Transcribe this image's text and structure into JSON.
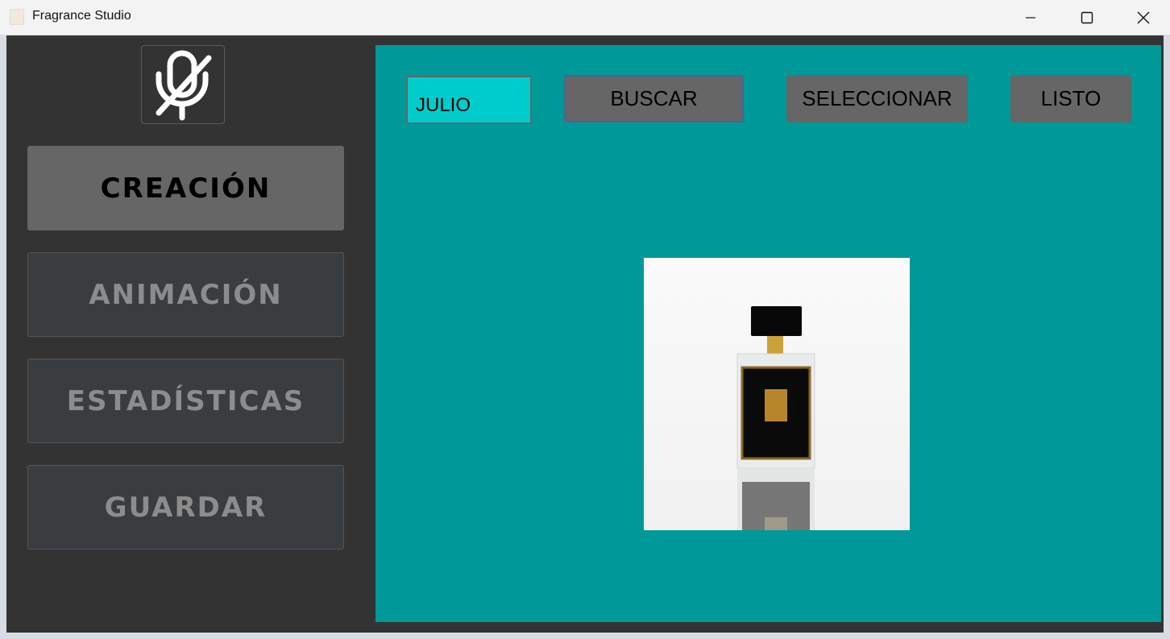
{
  "window": {
    "title": "Fragrance Studio"
  },
  "sidebar": {
    "items": [
      {
        "label": "CREACIÓN"
      },
      {
        "label": "ANIMACIÓN"
      },
      {
        "label": "ESTADÍSTICAS"
      },
      {
        "label": "GUARDAR"
      }
    ]
  },
  "toolbar": {
    "search_value": "JULIO",
    "buscar": "BUSCAR",
    "seleccionar": "SELECCIONAR",
    "listo": "LISTO"
  },
  "colors": {
    "panel": "#009999",
    "field": "#00cccc",
    "sidebar": "#333333"
  }
}
